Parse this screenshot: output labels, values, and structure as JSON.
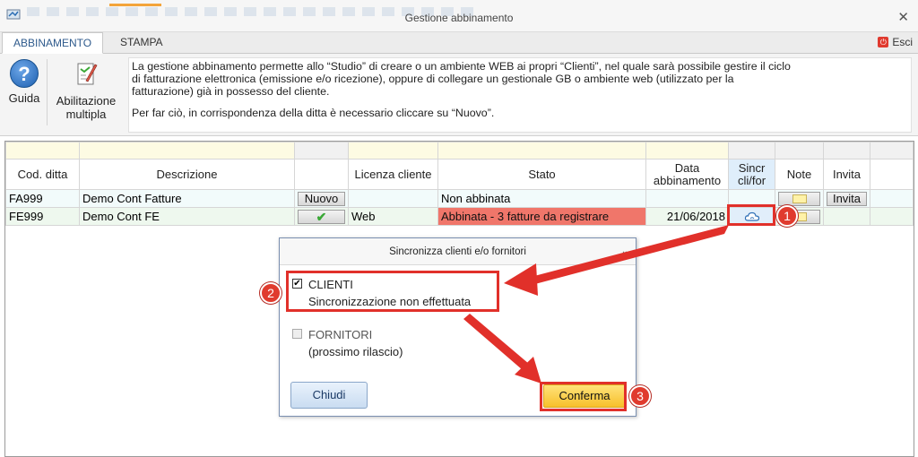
{
  "window": {
    "title": "Gestione abbinamento",
    "close_glyph": "✕"
  },
  "tabs": [
    {
      "label": "ABBINAMENTO",
      "active": true
    },
    {
      "label": "STAMPA",
      "active": false
    }
  ],
  "exit": {
    "label": "Esci"
  },
  "ribbon": {
    "guida_label": "Guida",
    "abil_line1": "Abilitazione",
    "abil_line2": "multipla",
    "info_p1_l1": "La gestione abbinamento permette allo “Studio” di creare o un ambiente WEB ai propri “Clienti”, nel quale sarà possibile gestire il ciclo",
    "info_p1_l2": "di fatturazione elettronica (emissione e/o ricezione), oppure di collegare un gestionale GB o ambiente web (utilizzato per la",
    "info_p1_l3": "fatturazione) già in possesso del cliente.",
    "info_p2": "Per far ciò, in corrispondenza della ditta è necessario cliccare su “Nuovo”."
  },
  "table": {
    "headers": {
      "cod": "Cod. ditta",
      "desc": "Descrizione",
      "act": "",
      "lic": "Licenza cliente",
      "stato": "Stato",
      "data_l1": "Data",
      "data_l2": "abbinamento",
      "sync_l1": "Sincr",
      "sync_l2": "cli/for",
      "note": "Note",
      "invita": "Invita"
    },
    "rows": [
      {
        "cod": "FA999",
        "desc": "Demo Cont Fatture",
        "action": "Nuovo",
        "licenza": "",
        "stato": "Non abbinata",
        "data": "",
        "invita": "Invita"
      },
      {
        "cod": "FE999",
        "desc": "Demo Cont FE",
        "action": "✔",
        "licenza": "Web",
        "stato": "Abbinata - 3 fatture da registrare",
        "data": "21/06/2018",
        "invita": ""
      }
    ]
  },
  "dialog": {
    "title": "Sincronizza clienti e/o fornitori",
    "clienti_label": "CLIENTI",
    "clienti_checked": true,
    "clienti_status": "Sincronizzazione non effettuata",
    "fornitori_label": "FORNITORI",
    "fornitori_checked": false,
    "fornitori_status": "(prossimo rilascio)",
    "chiudi_label": "Chiudi",
    "conferma_label": "Conferma"
  },
  "annotations": {
    "badge1": "1",
    "badge2": "2",
    "badge3": "3",
    "color": "#e1302a"
  }
}
